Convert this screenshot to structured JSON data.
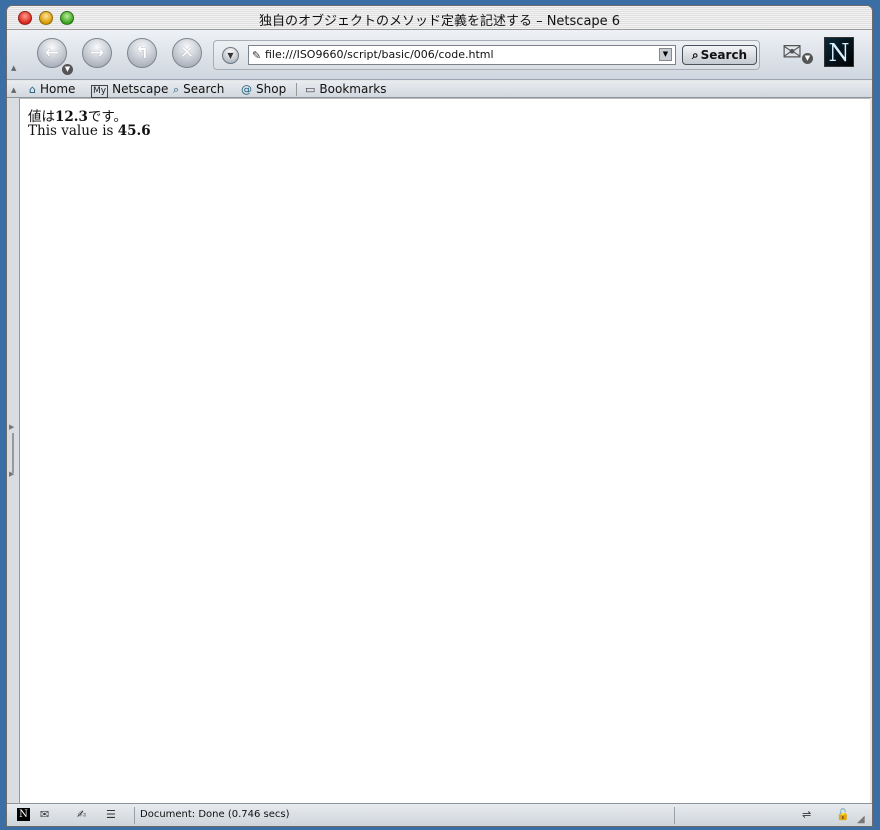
{
  "window": {
    "title": "独自のオブジェクトのメソッド定義を記述する – Netscape 6"
  },
  "toolbar": {
    "url": "file:///ISO9660/script/basic/006/code.html",
    "search_label": "Search"
  },
  "personal_toolbar": {
    "items": [
      {
        "label": "Home",
        "icon": "home-icon"
      },
      {
        "label": "Netscape",
        "icon": "my-netscape-icon"
      },
      {
        "label": "Search",
        "icon": "search-icon"
      },
      {
        "label": "Shop",
        "icon": "shop-icon"
      },
      {
        "label": "Bookmarks",
        "icon": "bookmarks-folder-icon"
      }
    ]
  },
  "content": {
    "line1": {
      "prefix": "値は",
      "value": "12.3",
      "suffix": "です。"
    },
    "line2": {
      "prefix": "This value is ",
      "value": "45.6"
    }
  },
  "status": {
    "text": "Document: Done (0.746 secs)"
  }
}
